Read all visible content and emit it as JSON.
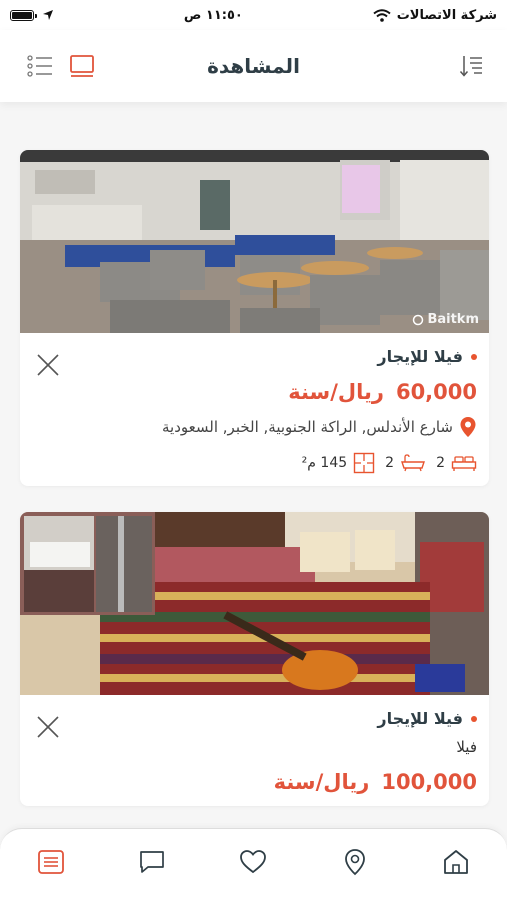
{
  "status_bar": {
    "carrier": "شركة الاتصالات",
    "time": "١١:٥٠ ص"
  },
  "header": {
    "title": "المشاهدة",
    "sort_icon": "sort-list-icon",
    "card_view_icon": "card-view-icon",
    "list_view_icon": "list-view-icon"
  },
  "colors": {
    "accent": "#e1543b",
    "title": "#2f3e46",
    "background": "#f6f6f6"
  },
  "listings": [
    {
      "type": "فيلا للإيجار",
      "price": "60,000",
      "price_unit": "ريال/سنة",
      "address": "شارع الأندلس, الراكة الجنوبية, الخبر, السعودية",
      "bedrooms": "2",
      "bathrooms": "2",
      "area": "145 م²",
      "watermark": "Baitkm"
    },
    {
      "type": "فيلا للإيجار",
      "sub_type": "فيلا",
      "price": "100,000",
      "price_unit": "ريال/سنة"
    }
  ],
  "tab_bar": {
    "items": [
      {
        "icon": "list-icon",
        "active": true
      },
      {
        "icon": "chat-icon",
        "active": false
      },
      {
        "icon": "heart-icon",
        "active": false
      },
      {
        "icon": "map-pin-icon",
        "active": false
      },
      {
        "icon": "home-icon",
        "active": false
      }
    ]
  }
}
